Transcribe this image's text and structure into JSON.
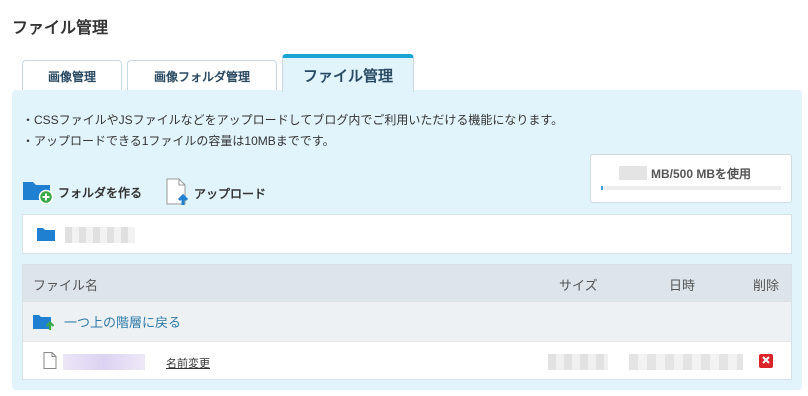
{
  "page": {
    "title": "ファイル管理"
  },
  "tabs": [
    {
      "label": "画像管理",
      "active": false
    },
    {
      "label": "画像フォルダ管理",
      "active": false
    },
    {
      "label": "ファイル管理",
      "active": true
    }
  ],
  "notes": [
    "・CSSファイルやJSファイルなどをアップロードしてブログ内でご利用いただける機能になります。",
    "・アップロードできる1ファイルの容量は10MBまでです。"
  ],
  "usage": {
    "label": "MB/500 MBを使用"
  },
  "actions": {
    "create_folder": "フォルダを作る",
    "upload": "アップロード"
  },
  "table": {
    "headers": {
      "name": "ファイル名",
      "size": "サイズ",
      "date": "日時",
      "delete": "削除"
    },
    "up_row": "一つ上の階層に戻る",
    "rows": [
      {
        "rename": "名前変更"
      }
    ]
  },
  "colors": {
    "accent": "#1aa2d3",
    "panel_bg": "#e1f4fc",
    "folder_icon": "#1f7fd1",
    "delete_icon": "#d9252a",
    "link": "#2d79a8"
  },
  "icons": {
    "folder": "folder-icon",
    "new_folder": "folder-plus-icon",
    "upload": "file-upload-icon",
    "up": "folder-up-icon",
    "file": "file-icon",
    "delete": "delete-icon"
  }
}
